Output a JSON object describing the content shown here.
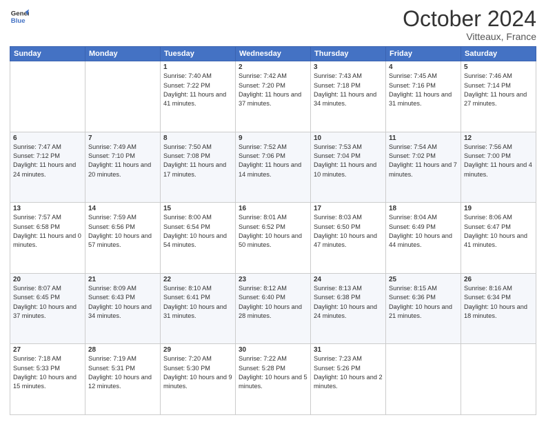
{
  "header": {
    "logo_line1": "General",
    "logo_line2": "Blue",
    "month": "October 2024",
    "location": "Vitteaux, France"
  },
  "weekdays": [
    "Sunday",
    "Monday",
    "Tuesday",
    "Wednesday",
    "Thursday",
    "Friday",
    "Saturday"
  ],
  "weeks": [
    [
      {
        "day": "",
        "info": ""
      },
      {
        "day": "",
        "info": ""
      },
      {
        "day": "1",
        "info": "Sunrise: 7:40 AM\nSunset: 7:22 PM\nDaylight: 11 hours and 41 minutes."
      },
      {
        "day": "2",
        "info": "Sunrise: 7:42 AM\nSunset: 7:20 PM\nDaylight: 11 hours and 37 minutes."
      },
      {
        "day": "3",
        "info": "Sunrise: 7:43 AM\nSunset: 7:18 PM\nDaylight: 11 hours and 34 minutes."
      },
      {
        "day": "4",
        "info": "Sunrise: 7:45 AM\nSunset: 7:16 PM\nDaylight: 11 hours and 31 minutes."
      },
      {
        "day": "5",
        "info": "Sunrise: 7:46 AM\nSunset: 7:14 PM\nDaylight: 11 hours and 27 minutes."
      }
    ],
    [
      {
        "day": "6",
        "info": "Sunrise: 7:47 AM\nSunset: 7:12 PM\nDaylight: 11 hours and 24 minutes."
      },
      {
        "day": "7",
        "info": "Sunrise: 7:49 AM\nSunset: 7:10 PM\nDaylight: 11 hours and 20 minutes."
      },
      {
        "day": "8",
        "info": "Sunrise: 7:50 AM\nSunset: 7:08 PM\nDaylight: 11 hours and 17 minutes."
      },
      {
        "day": "9",
        "info": "Sunrise: 7:52 AM\nSunset: 7:06 PM\nDaylight: 11 hours and 14 minutes."
      },
      {
        "day": "10",
        "info": "Sunrise: 7:53 AM\nSunset: 7:04 PM\nDaylight: 11 hours and 10 minutes."
      },
      {
        "day": "11",
        "info": "Sunrise: 7:54 AM\nSunset: 7:02 PM\nDaylight: 11 hours and 7 minutes."
      },
      {
        "day": "12",
        "info": "Sunrise: 7:56 AM\nSunset: 7:00 PM\nDaylight: 11 hours and 4 minutes."
      }
    ],
    [
      {
        "day": "13",
        "info": "Sunrise: 7:57 AM\nSunset: 6:58 PM\nDaylight: 11 hours and 0 minutes."
      },
      {
        "day": "14",
        "info": "Sunrise: 7:59 AM\nSunset: 6:56 PM\nDaylight: 10 hours and 57 minutes."
      },
      {
        "day": "15",
        "info": "Sunrise: 8:00 AM\nSunset: 6:54 PM\nDaylight: 10 hours and 54 minutes."
      },
      {
        "day": "16",
        "info": "Sunrise: 8:01 AM\nSunset: 6:52 PM\nDaylight: 10 hours and 50 minutes."
      },
      {
        "day": "17",
        "info": "Sunrise: 8:03 AM\nSunset: 6:50 PM\nDaylight: 10 hours and 47 minutes."
      },
      {
        "day": "18",
        "info": "Sunrise: 8:04 AM\nSunset: 6:49 PM\nDaylight: 10 hours and 44 minutes."
      },
      {
        "day": "19",
        "info": "Sunrise: 8:06 AM\nSunset: 6:47 PM\nDaylight: 10 hours and 41 minutes."
      }
    ],
    [
      {
        "day": "20",
        "info": "Sunrise: 8:07 AM\nSunset: 6:45 PM\nDaylight: 10 hours and 37 minutes."
      },
      {
        "day": "21",
        "info": "Sunrise: 8:09 AM\nSunset: 6:43 PM\nDaylight: 10 hours and 34 minutes."
      },
      {
        "day": "22",
        "info": "Sunrise: 8:10 AM\nSunset: 6:41 PM\nDaylight: 10 hours and 31 minutes."
      },
      {
        "day": "23",
        "info": "Sunrise: 8:12 AM\nSunset: 6:40 PM\nDaylight: 10 hours and 28 minutes."
      },
      {
        "day": "24",
        "info": "Sunrise: 8:13 AM\nSunset: 6:38 PM\nDaylight: 10 hours and 24 minutes."
      },
      {
        "day": "25",
        "info": "Sunrise: 8:15 AM\nSunset: 6:36 PM\nDaylight: 10 hours and 21 minutes."
      },
      {
        "day": "26",
        "info": "Sunrise: 8:16 AM\nSunset: 6:34 PM\nDaylight: 10 hours and 18 minutes."
      }
    ],
    [
      {
        "day": "27",
        "info": "Sunrise: 7:18 AM\nSunset: 5:33 PM\nDaylight: 10 hours and 15 minutes."
      },
      {
        "day": "28",
        "info": "Sunrise: 7:19 AM\nSunset: 5:31 PM\nDaylight: 10 hours and 12 minutes."
      },
      {
        "day": "29",
        "info": "Sunrise: 7:20 AM\nSunset: 5:30 PM\nDaylight: 10 hours and 9 minutes."
      },
      {
        "day": "30",
        "info": "Sunrise: 7:22 AM\nSunset: 5:28 PM\nDaylight: 10 hours and 5 minutes."
      },
      {
        "day": "31",
        "info": "Sunrise: 7:23 AM\nSunset: 5:26 PM\nDaylight: 10 hours and 2 minutes."
      },
      {
        "day": "",
        "info": ""
      },
      {
        "day": "",
        "info": ""
      }
    ]
  ]
}
